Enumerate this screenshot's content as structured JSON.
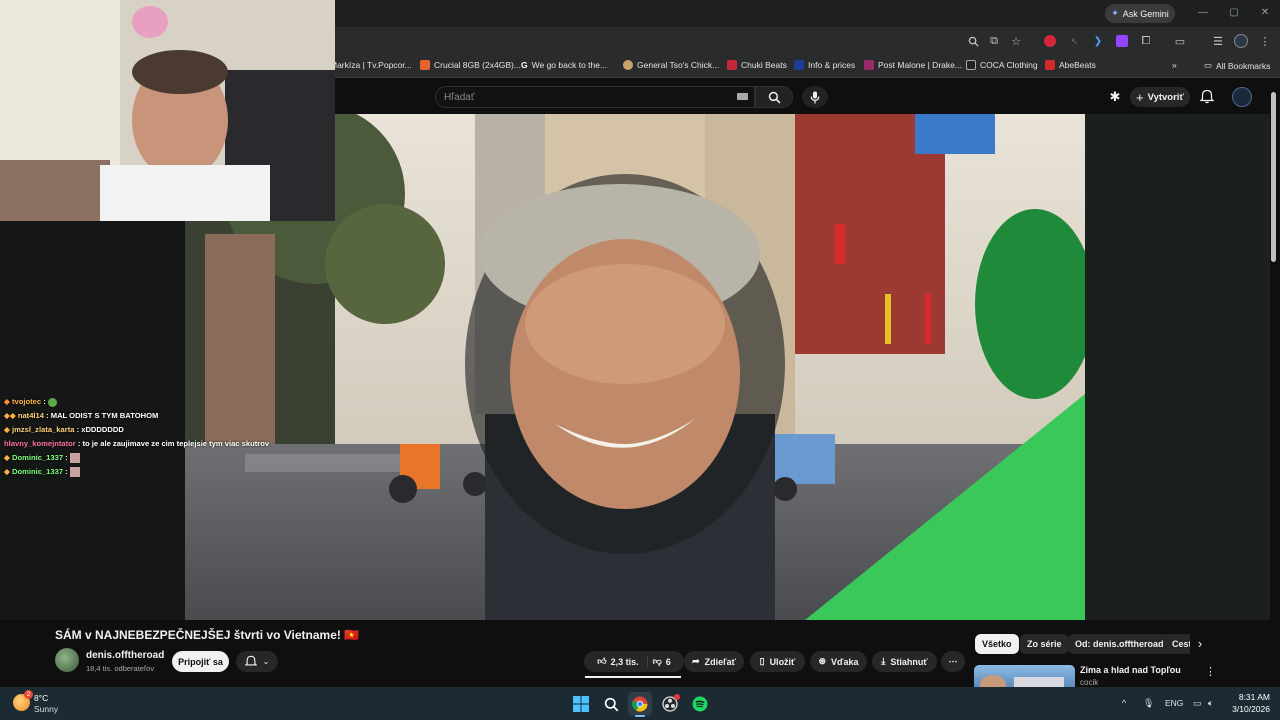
{
  "browser": {
    "ask_gemini": "Ask Gemini",
    "all_bookmarks": "All Bookmarks",
    "bookmarks": [
      {
        "label": "Markíza | Tv.Popcor...",
        "color": "#3a3b3d"
      },
      {
        "label": "Crucial 8GB (2x4GB)...",
        "color": "#e8622c"
      },
      {
        "label": "We go back to the...",
        "color": "#ffffff"
      },
      {
        "label": "General Tso's Chick...",
        "color": "#c8a46a"
      },
      {
        "label": "Chuki Beats",
        "color": "#c4283a"
      },
      {
        "label": "Info & prices",
        "color": "#1e3c9a"
      },
      {
        "label": "Post Malone | Drake...",
        "color": "#9a2a6a"
      },
      {
        "label": "COCA Clothing",
        "color": "#222222"
      },
      {
        "label": "AbeBeats",
        "color": "#d42a2a"
      }
    ]
  },
  "youtube": {
    "search_placeholder": "Hľadať",
    "create_label": "Vytvoriť",
    "video_title": "SÁM v NAJNEBEZPEČNEJŠEJ štvrti vo Vietname! 🇻🇳",
    "channel_name": "denis.offtheroad",
    "subscribers": "18,4 tis. odberateľov",
    "join_label": "Pripojiť sa",
    "likes": "2,3 tis.",
    "dislikes": "6",
    "share_label": "Zdieľať",
    "save_label": "Uložiť",
    "thanks_label": "Vďaka",
    "download_label": "Stiahnuť",
    "chips": [
      "Všetko",
      "Zo série",
      "Od: denis.offtheroad",
      "Cestovanie"
    ],
    "recommendation": {
      "title": "Zima a hlad nad Topľou",
      "channel": "cocik"
    }
  },
  "chat": [
    {
      "user": "tvojotec",
      "text": "",
      "user_color": "#ffb347",
      "emote": "#5fa84a"
    },
    {
      "user": "nat4l14",
      "text": "MAL ODIST S TYM BATOHOM",
      "user_color": "#ffd27a",
      "emote": ""
    },
    {
      "user": "jmzsl_zlata_karta",
      "text": "xDDDDDDD",
      "user_color": "#ffd27a",
      "emote": ""
    },
    {
      "user": "hlavny_komejntator",
      "text": "to je ale zaujimave ze cim teplejsie tym viac skutrov",
      "user_color": "#ff6fa8",
      "emote": ""
    },
    {
      "user": "Dominic_1337",
      "text": "",
      "user_color": "#7cff7c",
      "emote": "#c9a0a0"
    },
    {
      "user": "Dominic_1337",
      "text": "",
      "user_color": "#7cff7c",
      "emote": "#c9a0a0"
    }
  ],
  "taskbar": {
    "temperature": "8°C",
    "weather": "Sunny",
    "weather_badge": "2",
    "language": "ENG",
    "time": "8:31 AM",
    "date": "3/10/2026"
  }
}
